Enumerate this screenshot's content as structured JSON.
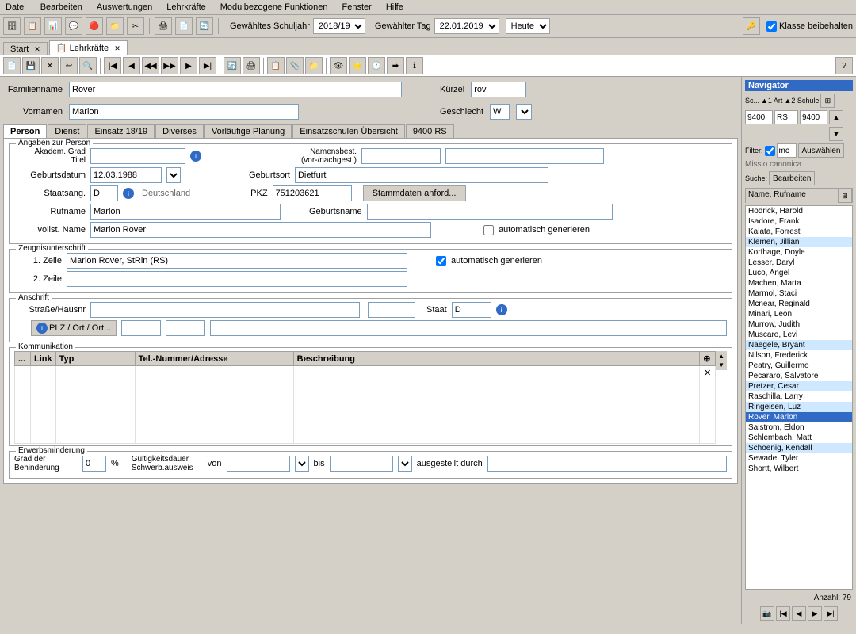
{
  "menubar": {
    "items": [
      "Datei",
      "Bearbeiten",
      "Auswertungen",
      "Lehrkräfte",
      "Modulbezogene Funktionen",
      "Fenster",
      "Hilfe"
    ]
  },
  "toolbar": {
    "schuljahr_label": "Gewähltes Schuljahr",
    "schuljahr_value": "2018/19",
    "tag_label": "Gewählter Tag",
    "tag_value": "22.01.2019",
    "heute_value": "Heute",
    "klasse_label": "Klasse beibehalten"
  },
  "tabs": [
    {
      "label": "Start",
      "closeable": true
    },
    {
      "label": "Lehrkräfte",
      "closeable": true,
      "active": true
    }
  ],
  "header_fields": {
    "familienname_label": "Familienname",
    "familienname_value": "Rover",
    "kuerzel_label": "Kürzel",
    "kuerzel_value": "rov",
    "vornamen_label": "Vornamen",
    "vornamen_value": "Marlon",
    "geschlecht_label": "Geschlecht",
    "geschlecht_value": "W"
  },
  "person_tabs": [
    "Person",
    "Dienst",
    "Einsatz 18/19",
    "Diverses",
    "Vorläufige Planung",
    "Einsatzschulen Übersicht",
    "9400 RS"
  ],
  "angaben_section": {
    "title": "Angaben zur Person",
    "akadem_label": "Akadem. Grad Titel",
    "namensbest_label": "Namensbest. (vor-/nachgest.)",
    "gebdatum_label": "Geburtsdatum",
    "gebdatum_value": "12.03.1988",
    "geburtsort_label": "Geburtsort",
    "geburtsort_value": "Dietfurt",
    "staatsang_label": "Staatsang.",
    "staatsang_value": "D",
    "staatsang_text": "Deutschland",
    "pkz_label": "PKZ",
    "pkz_value": "751203621",
    "stammdaten_btn": "Stammdaten anford...",
    "rufname_label": "Rufname",
    "rufname_value": "Marlon",
    "geburtsname_label": "Geburtsname",
    "vollst_label": "vollst. Name",
    "vollst_value": "Marlon Rover",
    "autogen_label": "automatisch generieren"
  },
  "zeugnis_section": {
    "title": "Zeugnisunterschrift",
    "zeile1_label": "1. Zeile",
    "zeile1_value": "Marlon Rover, StRin (RS)",
    "zeile1_autogen": "automatisch generieren",
    "zeile2_label": "2. Zeile"
  },
  "anschrift_section": {
    "title": "Anschrift",
    "strasse_label": "Straße/Hausnr",
    "staat_label": "Staat",
    "staat_value": "D",
    "plz_btn": "PLZ / Ort / Ort..."
  },
  "kommunikation_section": {
    "title": "Kommunikation",
    "columns": [
      "...",
      "Link",
      "Typ",
      "Tel.-Nummer/Adresse",
      "Beschreibung"
    ]
  },
  "erwerbs_section": {
    "title": "Erwerbsminderung",
    "grad_label": "Grad der Behinderung",
    "grad_value": "0",
    "percent": "%",
    "guelt_label": "Gültigkeitsdauer Schwerb.ausweis",
    "von_label": "von",
    "bis_label": "bis",
    "ausgestellt_label": "ausgestellt durch"
  },
  "navigator": {
    "title": "Navigator",
    "sc_label": "Sc...",
    "art_label": "▲1 Art",
    "schule_label": "▲2 Schule",
    "val1": "9400",
    "val2": "RS",
    "val3": "9400",
    "filter_label": "Filter:",
    "filter_value": "mc",
    "auswaehlen_btn": "Auswählen",
    "missio_text": "Missio canonica",
    "suche_label": "Suche:",
    "bearbeiten_btn": "Bearbeiten",
    "name_col": "Name, Rufname",
    "list_items": [
      {
        "label": "Hodrick, Harold",
        "highlight": false
      },
      {
        "label": "Isadore, Frank",
        "highlight": false
      },
      {
        "label": "Kalata, Forrest",
        "highlight": false
      },
      {
        "label": "Klemen, Jillian",
        "highlight": true
      },
      {
        "label": "Korfhage, Doyle",
        "highlight": false
      },
      {
        "label": "Lesser, Daryl",
        "highlight": false
      },
      {
        "label": "Luco, Angel",
        "highlight": false
      },
      {
        "label": "Machen, Marta",
        "highlight": false
      },
      {
        "label": "Marmol, Staci",
        "highlight": false
      },
      {
        "label": "Mcnear, Reginald",
        "highlight": false
      },
      {
        "label": "Minari, Leon",
        "highlight": false
      },
      {
        "label": "Murrow, Judith",
        "highlight": false
      },
      {
        "label": "Muscaro, Levi",
        "highlight": false
      },
      {
        "label": "Naegele, Bryant",
        "highlight": true
      },
      {
        "label": "Nilson, Frederick",
        "highlight": false
      },
      {
        "label": "Peatry, Guillermo",
        "highlight": false
      },
      {
        "label": "Pecararo, Salvatore",
        "highlight": false
      },
      {
        "label": "Pretzer, Cesar",
        "highlight": true
      },
      {
        "label": "Raschilla, Larry",
        "highlight": false
      },
      {
        "label": "Ringeisen, Luz",
        "highlight": true
      },
      {
        "label": "Rover, Marlon",
        "selected": true
      },
      {
        "label": "Salstrom, Eldon",
        "highlight": false
      },
      {
        "label": "Schlembach, Matt",
        "highlight": false
      },
      {
        "label": "Schoenig, Kendall",
        "highlight": true
      },
      {
        "label": "Sewade, Tyler",
        "highlight": false
      },
      {
        "label": "Shortt, Wilbert",
        "highlight": false
      }
    ],
    "anzahl_label": "Anzahl: 79"
  }
}
